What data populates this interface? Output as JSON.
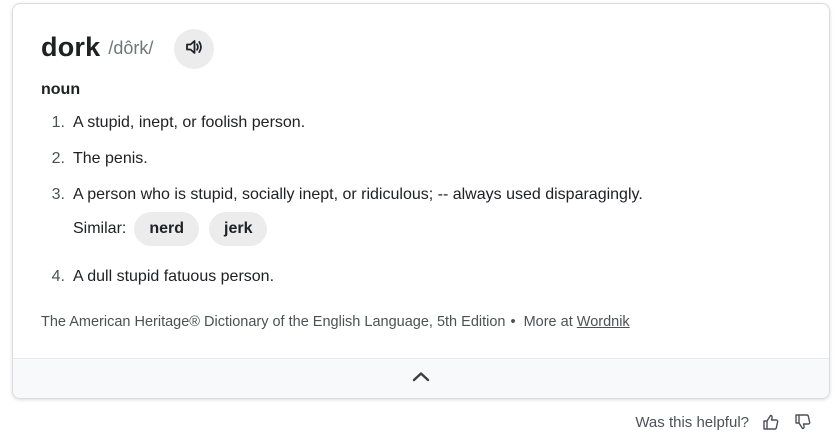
{
  "entry": {
    "word": "dork",
    "phonetic": "/dôrk/",
    "part_of_speech": "noun"
  },
  "icons": {
    "speaker": "speaker-icon",
    "collapse": "chevron-up-icon",
    "thumbs_up": "thumbs-up-icon",
    "thumbs_down": "thumbs-down-icon"
  },
  "definitions": [
    {
      "num": "1.",
      "text": "A stupid, inept, or foolish person."
    },
    {
      "num": "2.",
      "text": "The penis."
    },
    {
      "num": "3.",
      "text": "A person who is stupid, socially inept, or ridiculous; -- always used disparagingly."
    },
    {
      "num": "4.",
      "text": "A dull stupid fatuous person."
    }
  ],
  "similar": {
    "label": "Similar:",
    "words": [
      "nerd",
      "jerk"
    ]
  },
  "source": {
    "text": "The American Heritage® Dictionary of the English Language, 5th Edition",
    "separator": "•",
    "more_label": "More at",
    "link": "Wordnik"
  },
  "feedback": {
    "question": "Was this helpful?"
  }
}
